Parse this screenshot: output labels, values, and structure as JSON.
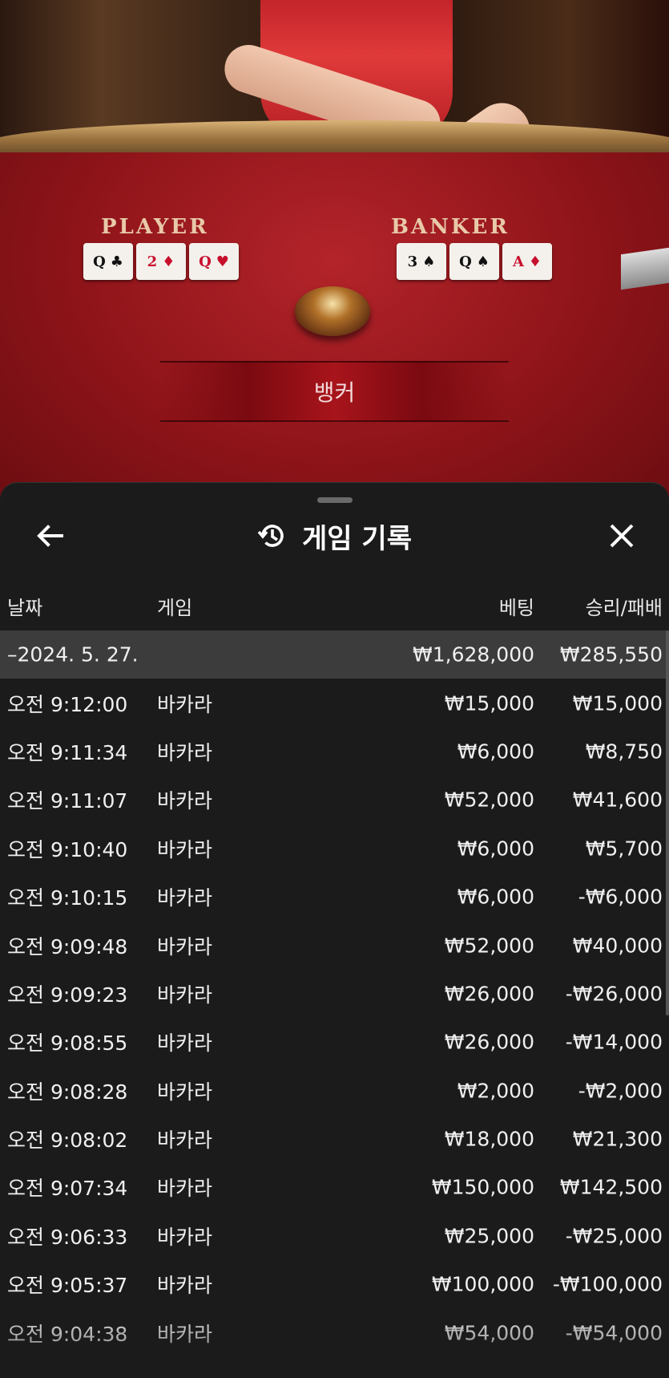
{
  "table": {
    "player_label": "PLAYER",
    "banker_label": "BANKER",
    "player_cards": [
      {
        "rank": "Q",
        "suit": "♣",
        "red": false
      },
      {
        "rank": "2",
        "suit": "♦",
        "red": true
      },
      {
        "rank": "Q",
        "suit": "♥",
        "red": true
      }
    ],
    "banker_cards": [
      {
        "rank": "3",
        "suit": "♠",
        "red": false
      },
      {
        "rank": "Q",
        "suit": "♠",
        "red": false
      },
      {
        "rank": "A",
        "suit": "♦",
        "red": true
      }
    ],
    "result_banner": "뱅커"
  },
  "sheet": {
    "title": "게임 기록",
    "back_icon": "back-arrow-icon",
    "history_icon": "history-clock-icon",
    "close_icon": "close-icon",
    "columns": {
      "date": "날짜",
      "game": "게임",
      "bet": "베팅",
      "result": "승리/패배"
    },
    "summary": {
      "date": "–2024. 5. 27.",
      "game": "",
      "bet": "₩1,628,000",
      "result": "₩285,550"
    },
    "rows": [
      {
        "date": "오전 9:12:00",
        "game": "바카라",
        "bet": "₩15,000",
        "result": "₩15,000"
      },
      {
        "date": "오전 9:11:34",
        "game": "바카라",
        "bet": "₩6,000",
        "result": "₩8,750"
      },
      {
        "date": "오전 9:11:07",
        "game": "바카라",
        "bet": "₩52,000",
        "result": "₩41,600"
      },
      {
        "date": "오전 9:10:40",
        "game": "바카라",
        "bet": "₩6,000",
        "result": "₩5,700"
      },
      {
        "date": "오전 9:10:15",
        "game": "바카라",
        "bet": "₩6,000",
        "result": "-₩6,000"
      },
      {
        "date": "오전 9:09:48",
        "game": "바카라",
        "bet": "₩52,000",
        "result": "₩40,000"
      },
      {
        "date": "오전 9:09:23",
        "game": "바카라",
        "bet": "₩26,000",
        "result": "-₩26,000"
      },
      {
        "date": "오전 9:08:55",
        "game": "바카라",
        "bet": "₩26,000",
        "result": "-₩14,000"
      },
      {
        "date": "오전 9:08:28",
        "game": "바카라",
        "bet": "₩2,000",
        "result": "-₩2,000"
      },
      {
        "date": "오전 9:08:02",
        "game": "바카라",
        "bet": "₩18,000",
        "result": "₩21,300"
      },
      {
        "date": "오전 9:07:34",
        "game": "바카라",
        "bet": "₩150,000",
        "result": "₩142,500"
      },
      {
        "date": "오전 9:06:33",
        "game": "바카라",
        "bet": "₩25,000",
        "result": "-₩25,000"
      },
      {
        "date": "오전 9:05:37",
        "game": "바카라",
        "bet": "₩100,000",
        "result": "-₩100,000"
      },
      {
        "date": "오전 9:04:38",
        "game": "바카라",
        "bet": "₩54,000",
        "result": "-₩54,000"
      }
    ]
  }
}
